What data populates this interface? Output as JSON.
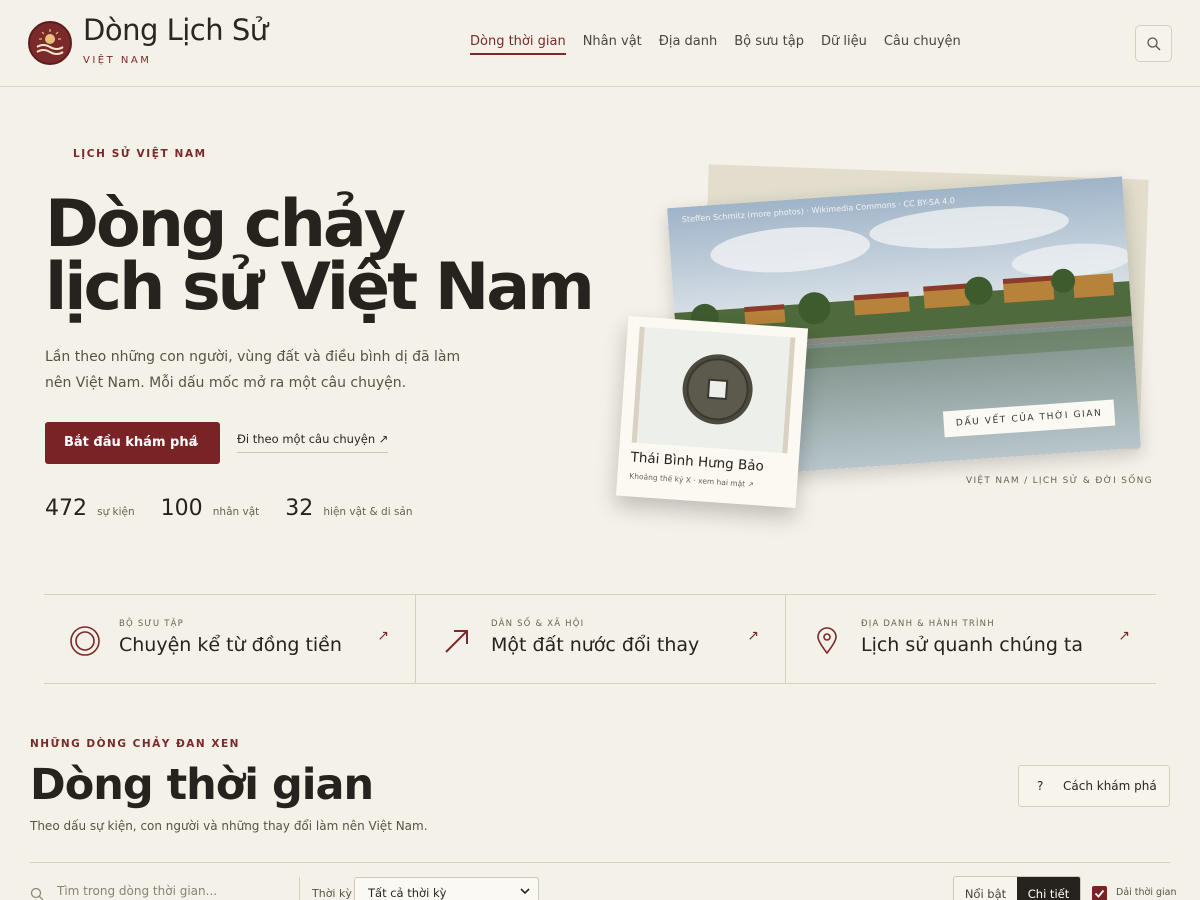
{
  "header": {
    "brand_title": "Dòng Lịch Sử",
    "brand_subtitle": "VIỆT NAM",
    "nav": [
      {
        "label": "Dòng thời gian",
        "active": true
      },
      {
        "label": "Nhân vật"
      },
      {
        "label": "Địa danh"
      },
      {
        "label": "Bộ sưu tập"
      },
      {
        "label": "Dữ liệu"
      },
      {
        "label": "Câu chuyện"
      }
    ],
    "search_icon": "search-icon"
  },
  "hero": {
    "eyebrow": "LỊCH SỬ VIỆT NAM",
    "title_line1": "Dòng chảy",
    "title_line2": "lịch sử Việt Nam",
    "description": "Lần theo những con người, vùng đất và điều bình dị đã làm nên Việt Nam. Mỗi dấu mốc mở ra một câu chuyện.",
    "cta_label": "Bắt đầu khám phá",
    "cta_arrow": "↓",
    "story_link": "Đi theo một câu chuyện ↗",
    "stats": [
      {
        "value": "472",
        "label": "sự kiện"
      },
      {
        "value": "100",
        "label": "nhân vật"
      },
      {
        "value": "32",
        "label": "hiện vật & di sản"
      }
    ]
  },
  "collage": {
    "photo_credit": "Steffen Schmitz (more photos) · Wikimedia Commons · CC BY-SA 4.0",
    "photo_tag": "DẤU VẾT CỦA THỜI GIAN",
    "photo_caption": "VIỆT NAM / LỊCH SỬ & ĐỜI SỐNG",
    "coin_title": "Thái Bình Hưng Bảo",
    "coin_meta": "Khoảng thế kỷ X · xem hai mặt ↗"
  },
  "features": [
    {
      "kicker": "BỘ SƯU TẬP",
      "title": "Chuyện kể từ đồng tiền",
      "icon": "coin-icon",
      "arrow": "↗"
    },
    {
      "kicker": "DÂN SỐ & XÃ HỘI",
      "title": "Một đất nước đổi thay",
      "icon": "trend-arrow-icon",
      "arrow": "↗"
    },
    {
      "kicker": "ĐỊA DANH & HÀNH TRÌNH",
      "title": "Lịch sử quanh chúng ta",
      "icon": "map-pin-icon",
      "arrow": "↗"
    }
  ],
  "timeline": {
    "eyebrow": "NHỮNG DÒNG CHẢY ĐAN XEN",
    "title": "Dòng thời gian",
    "description": "Theo dấu sự kiện, con người và những thay đổi làm nên Việt Nam.",
    "explore_q": "?",
    "explore_label": "Cách khám phá",
    "search_placeholder": "Tìm trong dòng thời gian...",
    "period_label": "Thời kỳ",
    "period_value": "Tất cả thời kỳ",
    "view_options": [
      "Nổi bật",
      "Chi tiết"
    ],
    "view_selected": "Chi tiết",
    "checkbox_label": "Dải thời gian",
    "checkbox_checked": true
  },
  "colors": {
    "accent": "#7a2326",
    "background": "#f4f1e9",
    "ink": "#26221e"
  }
}
